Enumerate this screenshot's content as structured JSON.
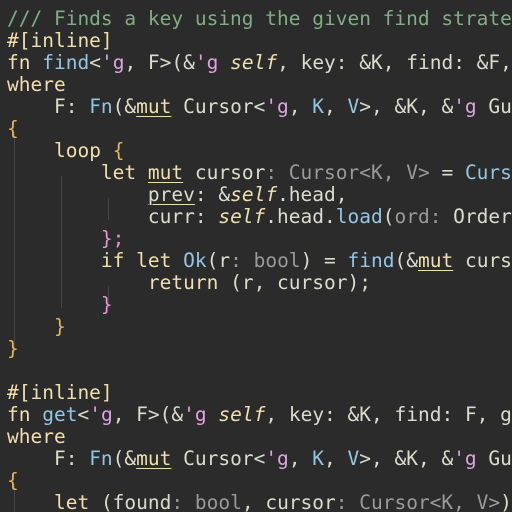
{
  "colors": {
    "background": "#2b2b2b",
    "text": "#dcdccc",
    "comment": "#7fae84",
    "keyword": "#f0dfaf",
    "bracket": "#e392d9",
    "brace": "#e4b45a",
    "function": "#93c6e3",
    "lifetime": "#e0a2e0",
    "selfkw": "#f0dfaf",
    "type": "#dcdccc",
    "hint": "#9a9a9a",
    "underline": "#f0dfaf"
  },
  "lines": [
    [
      {
        "t": "/// Finds a key using the given find strategy",
        "c": "comment"
      }
    ],
    [
      {
        "t": "#[inline]",
        "c": "keyword"
      }
    ],
    [
      {
        "t": "fn",
        "c": "keyword"
      },
      {
        "t": " "
      },
      {
        "t": "find",
        "c": "function"
      },
      {
        "t": "<"
      },
      {
        "t": "'g",
        "c": "lifetime"
      },
      {
        "t": ", F>(&"
      },
      {
        "t": "'g",
        "c": "lifetime"
      },
      {
        "t": " "
      },
      {
        "t": "self",
        "c": "selfkw",
        "i": true
      },
      {
        "t": ", key: &K, find: &F, g"
      }
    ],
    [
      {
        "t": "where",
        "c": "keyword"
      }
    ],
    [
      {
        "t": "    F: "
      },
      {
        "t": "Fn",
        "c": "function"
      },
      {
        "t": "(&"
      },
      {
        "t": "mut",
        "c": "keyword",
        "u": true
      },
      {
        "t": " Cursor<"
      },
      {
        "t": "'g",
        "c": "lifetime"
      },
      {
        "t": ", "
      },
      {
        "t": "K",
        "c": "function"
      },
      {
        "t": ", "
      },
      {
        "t": "V",
        "c": "function"
      },
      {
        "t": ">, &K, &"
      },
      {
        "t": "'g",
        "c": "lifetime"
      },
      {
        "t": " Gu"
      }
    ],
    [
      {
        "t": "{",
        "c": "brace"
      }
    ],
    [
      {
        "t": "    "
      },
      {
        "t": "loop",
        "c": "keyword"
      },
      {
        "t": " "
      },
      {
        "t": "{",
        "c": "brace"
      }
    ],
    [
      {
        "t": "        "
      },
      {
        "t": "let",
        "c": "keyword"
      },
      {
        "t": " "
      },
      {
        "t": "mut",
        "c": "keyword",
        "u": true
      },
      {
        "t": " cursor"
      },
      {
        "t": ": Cursor<K, V>",
        "c": "hint"
      },
      {
        "t": " = "
      },
      {
        "t": "Curs",
        "c": "function"
      }
    ],
    [
      {
        "t": "            "
      },
      {
        "t": "prev",
        "u": true
      },
      {
        "t": ": &"
      },
      {
        "t": "self",
        "c": "selfkw",
        "i": true
      },
      {
        "t": ".head,"
      }
    ],
    [
      {
        "t": "            curr: "
      },
      {
        "t": "self",
        "c": "selfkw",
        "i": true
      },
      {
        "t": ".head."
      },
      {
        "t": "load",
        "c": "function"
      },
      {
        "t": "("
      },
      {
        "t": "ord: ",
        "c": "hint"
      },
      {
        "t": "Orderi"
      }
    ],
    [
      {
        "t": "        "
      },
      {
        "t": "};",
        "c": "bracket"
      }
    ],
    [
      {
        "t": "        "
      },
      {
        "t": "if",
        "c": "keyword"
      },
      {
        "t": " "
      },
      {
        "t": "let",
        "c": "keyword"
      },
      {
        "t": " "
      },
      {
        "t": "Ok",
        "c": "function"
      },
      {
        "t": "(r"
      },
      {
        "t": ": bool",
        "c": "hint"
      },
      {
        "t": ") = "
      },
      {
        "t": "find",
        "c": "function"
      },
      {
        "t": "(&"
      },
      {
        "t": "mut",
        "c": "keyword",
        "u": true
      },
      {
        "t": " curs"
      }
    ],
    [
      {
        "t": "            "
      },
      {
        "t": "return",
        "c": "keyword"
      },
      {
        "t": " (r, cursor);"
      }
    ],
    [
      {
        "t": "        "
      },
      {
        "t": "}",
        "c": "bracket"
      }
    ],
    [
      {
        "t": "    "
      },
      {
        "t": "}",
        "c": "brace"
      }
    ],
    [
      {
        "t": "}",
        "c": "brace"
      }
    ],
    [],
    [
      {
        "t": "#[inline]",
        "c": "keyword"
      }
    ],
    [
      {
        "t": "fn",
        "c": "keyword"
      },
      {
        "t": " "
      },
      {
        "t": "get",
        "c": "function"
      },
      {
        "t": "<"
      },
      {
        "t": "'g",
        "c": "lifetime"
      },
      {
        "t": ", F>(&"
      },
      {
        "t": "'g",
        "c": "lifetime"
      },
      {
        "t": " "
      },
      {
        "t": "self",
        "c": "selfkw",
        "i": true
      },
      {
        "t": ", key: &K, find: F, g"
      }
    ],
    [
      {
        "t": "where",
        "c": "keyword"
      }
    ],
    [
      {
        "t": "    F: "
      },
      {
        "t": "Fn",
        "c": "function"
      },
      {
        "t": "(&"
      },
      {
        "t": "mut",
        "c": "keyword",
        "u": true
      },
      {
        "t": " Cursor<"
      },
      {
        "t": "'g",
        "c": "lifetime"
      },
      {
        "t": ", "
      },
      {
        "t": "K",
        "c": "function"
      },
      {
        "t": ", "
      },
      {
        "t": "V",
        "c": "function"
      },
      {
        "t": ">, &K, &"
      },
      {
        "t": "'g",
        "c": "lifetime"
      },
      {
        "t": " Gu"
      }
    ],
    [
      {
        "t": "{",
        "c": "brace"
      }
    ],
    [
      {
        "t": "    "
      },
      {
        "t": "let",
        "c": "keyword"
      },
      {
        "t": " (found"
      },
      {
        "t": ": bool",
        "c": "hint"
      },
      {
        "t": ", cursor"
      },
      {
        "t": ": Cursor<K, V>",
        "c": "hint"
      },
      {
        "t": ")"
      }
    ]
  ]
}
